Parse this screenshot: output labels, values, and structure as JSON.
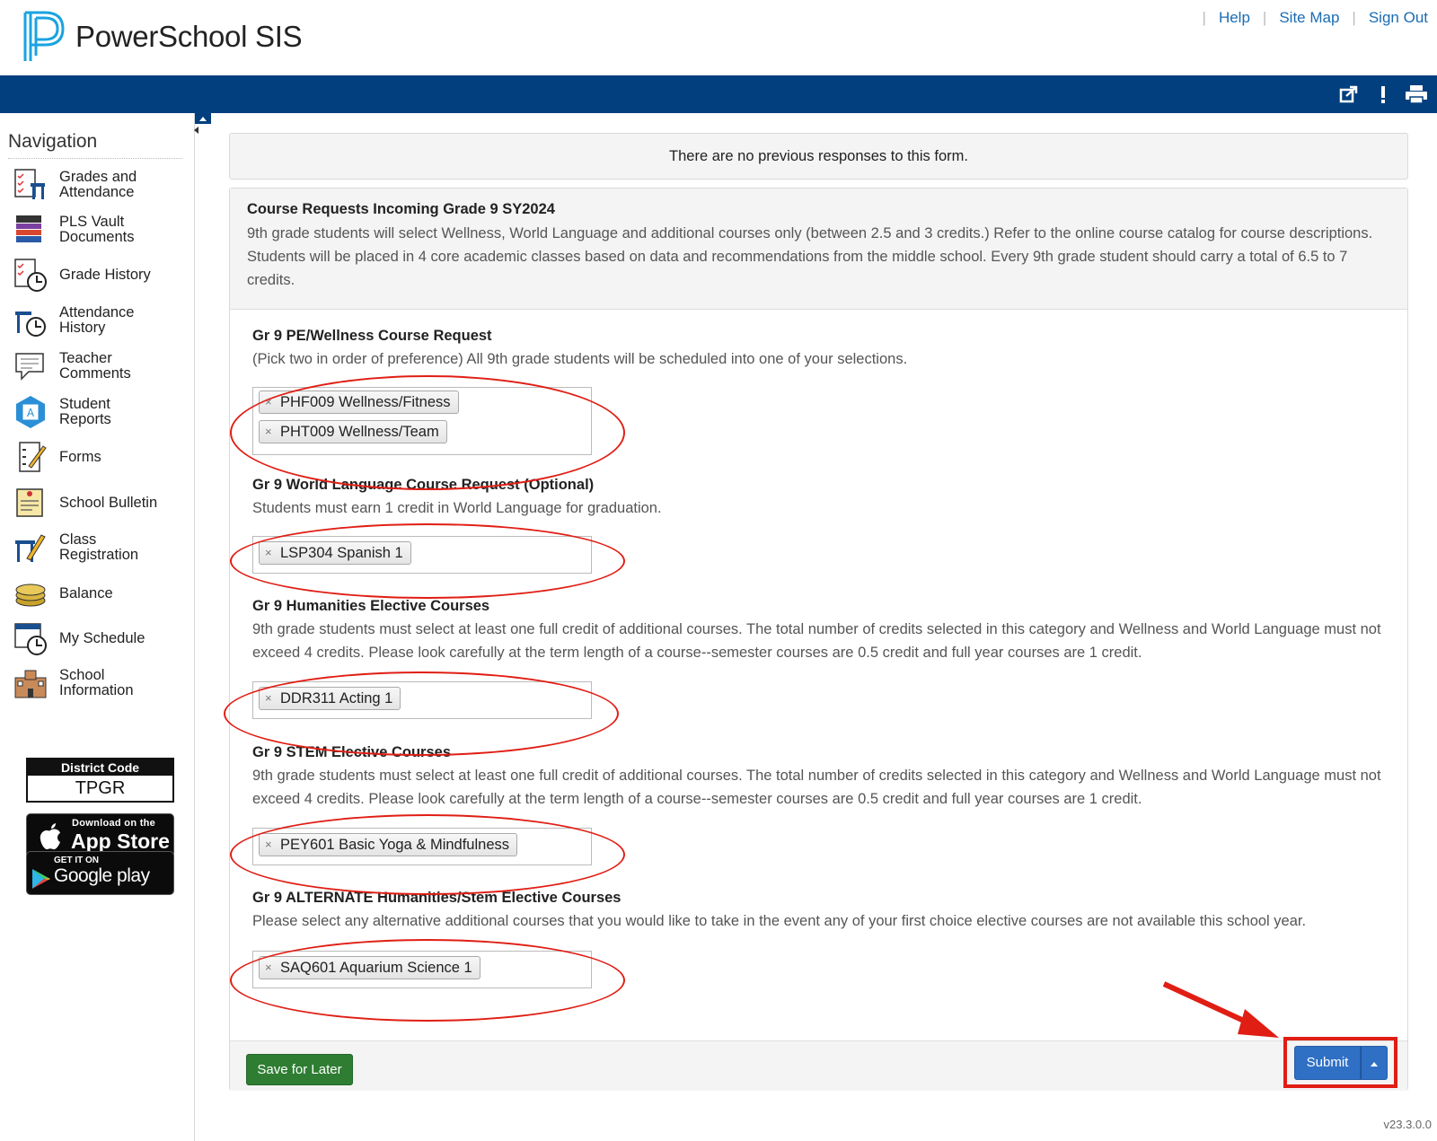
{
  "header": {
    "brand": "PowerSchool SIS",
    "links": {
      "help": "Help",
      "site_map": "Site Map",
      "sign_out": "Sign Out"
    }
  },
  "sidebar": {
    "title": "Navigation",
    "items": [
      {
        "line1": "Grades and",
        "line2": "Attendance",
        "icon": "grades-attendance-icon"
      },
      {
        "line1": "PLS Vault",
        "line2": "Documents",
        "icon": "vault-documents-icon"
      },
      {
        "line1": "Grade History",
        "line2": "",
        "icon": "grade-history-icon"
      },
      {
        "line1": "Attendance",
        "line2": "History",
        "icon": "attendance-history-icon"
      },
      {
        "line1": "Teacher",
        "line2": "Comments",
        "icon": "teacher-comments-icon"
      },
      {
        "line1": "Student",
        "line2": "Reports",
        "icon": "student-reports-icon"
      },
      {
        "line1": "Forms",
        "line2": "",
        "icon": "forms-icon"
      },
      {
        "line1": "School Bulletin",
        "line2": "",
        "icon": "school-bulletin-icon"
      },
      {
        "line1": "Class",
        "line2": "Registration",
        "icon": "class-registration-icon"
      },
      {
        "line1": "Balance",
        "line2": "",
        "icon": "balance-icon"
      },
      {
        "line1": "My Schedule",
        "line2": "",
        "icon": "my-schedule-icon"
      },
      {
        "line1": "School",
        "line2": "Information",
        "icon": "school-information-icon"
      }
    ],
    "district_code_label": "District Code",
    "district_code": "TPGR",
    "app_store": {
      "small": "Download on the",
      "big": "App Store"
    },
    "google_play": {
      "small": "GET IT ON",
      "big": "Google play"
    }
  },
  "notice": "There are no previous responses to this form.",
  "form": {
    "title": "Course Requests Incoming Grade 9 SY2024",
    "description": "9th grade students will select Wellness, World Language and additional courses only (between 2.5 and 3 credits.) Refer to the online course catalog for course descriptions. Students will be placed in 4 core academic classes based on data and recommendations from the middle school. Every 9th grade student should carry a total of 6.5 to 7 credits.",
    "questions": [
      {
        "title": "Gr 9 PE/Wellness Course Request",
        "description": "(Pick two in order of preference) All 9th grade students will be scheduled into one of your selections.",
        "selections": [
          "PHF009 Wellness/Fitness",
          "PHT009 Wellness/Team"
        ]
      },
      {
        "title": "Gr 9 World Language Course Request (Optional)",
        "description": "Students must earn 1 credit in World Language for graduation.",
        "selections": [
          "LSP304 Spanish 1"
        ]
      },
      {
        "title": "Gr 9 Humanities Elective Courses",
        "description": "9th grade students must select at least one full credit of additional courses. The total number of credits selected in this category and Wellness and World Language must not exceed 4 credits. Please look carefully at the term length of a course--semester courses are 0.5 credit and full year courses are 1 credit.",
        "selections": [
          "DDR311 Acting 1"
        ]
      },
      {
        "title": "Gr 9 STEM Elective Courses",
        "description": "9th grade students must select at least one full credit of additional courses. The total number of credits selected in this category and Wellness and World Language must not exceed 4 credits. Please look carefully at the term length of a course--semester courses are 0.5 credit and full year courses are 1 credit.",
        "selections": [
          "PEY601 Basic Yoga & Mindfulness"
        ]
      },
      {
        "title": "Gr 9 ALTERNATE Humanities/Stem Elective Courses",
        "description": "Please select any alternative additional courses that you would like to take in the event any of your first choice elective courses are not available this school year.",
        "selections": [
          "SAQ601 Aquarium Science 1"
        ]
      }
    ],
    "chip_remove": "×",
    "save_label": "Save for Later",
    "submit_label": "Submit"
  },
  "version": "v23.3.0.0",
  "colors": {
    "brand_blue": "#023f7e",
    "link": "#1a6cb4",
    "save_green": "#2e7d32",
    "submit_blue": "#2f70c5",
    "annotation_red": "#e01e14"
  }
}
